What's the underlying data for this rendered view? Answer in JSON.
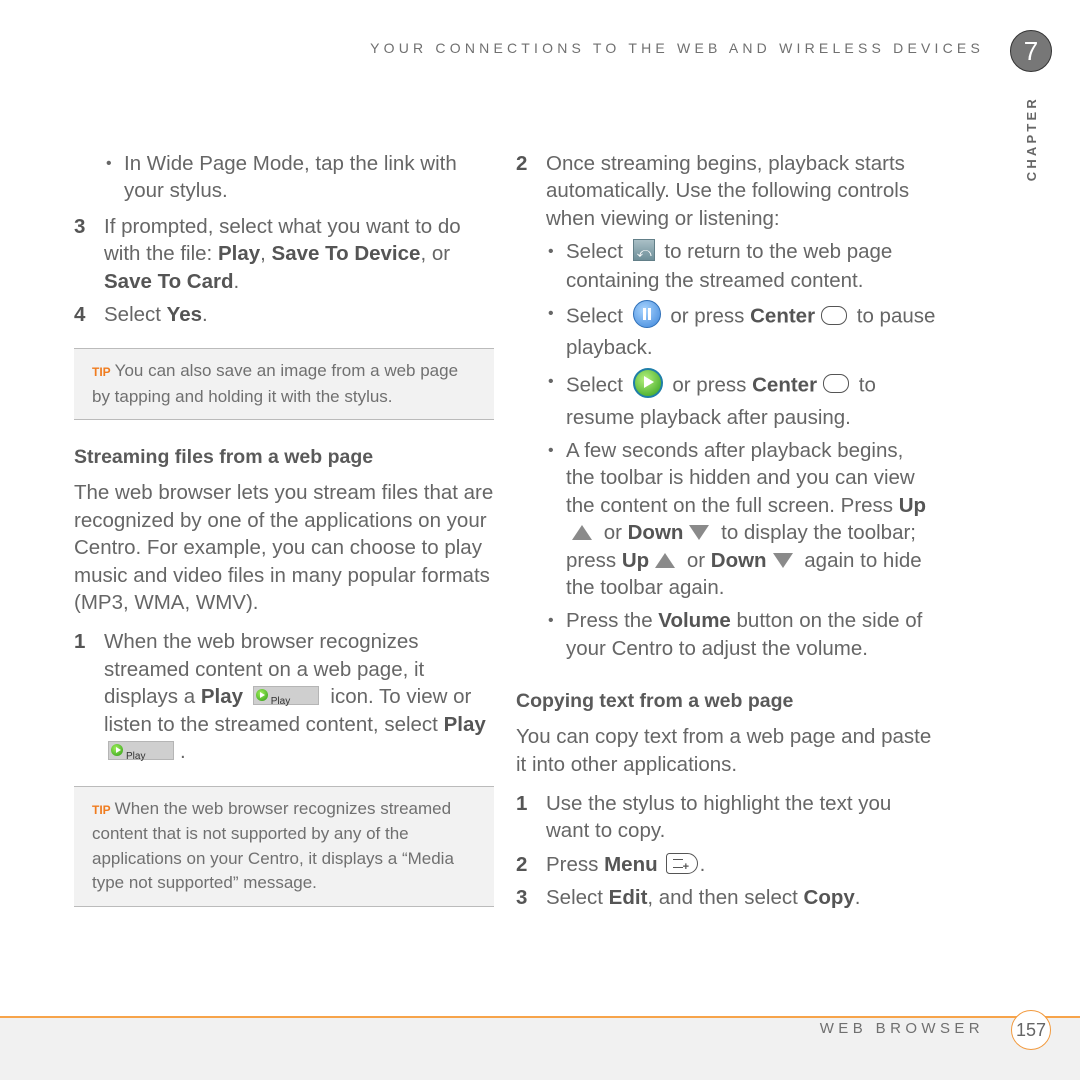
{
  "header": {
    "running_head": "YOUR CONNECTIONS TO THE WEB AND WIRELESS DEVICES",
    "chapter_number": "7",
    "chapter_label": "CHAPTER"
  },
  "left": {
    "bullet_wide_page": "In Wide Page Mode, tap the link with your stylus.",
    "step3": {
      "num": "3",
      "text_a": "If prompted, select what you want to do with the file: ",
      "bold_play": "Play",
      "sep1": ", ",
      "bold_save_device": "Save To Device",
      "sep2": ", or ",
      "bold_save_card": "Save To Card",
      "end": "."
    },
    "step4": {
      "num": "4",
      "text_a": "Select ",
      "bold_yes": "Yes",
      "end": "."
    },
    "tip1": {
      "label": "TIP",
      "text": "You can also save an image from a web page by tapping and holding it with the stylus."
    },
    "section_heading": "Streaming files from a web page",
    "intro": "The web browser lets you stream files that are recognized by one of the applications on your Centro. For example, you can choose to play music and video files in many popular formats (MP3, WMA, WMV).",
    "step1": {
      "num": "1",
      "text_a": "When the web browser recognizes streamed content on a web page, it displays a ",
      "bold_play": "Play",
      "text_b": " icon. To view or listen to the streamed content, select ",
      "bold_play2": "Play",
      "end": "."
    },
    "play_icon_label": "Play",
    "tip2": {
      "label": "TIP",
      "text": "When the web browser recognizes streamed content that is not supported by any of the applications on your Centro, it displays a “Media type not supported” message."
    }
  },
  "right": {
    "step2": {
      "num": "2",
      "text": "Once streaming begins, playback starts automatically. Use the following controls when viewing or listening:"
    },
    "bullet_back": {
      "a": "Select ",
      "b": " to return to the web page containing the streamed content."
    },
    "bullet_pause": {
      "a": "Select ",
      "b": " or press ",
      "bold_center": "Center",
      "c": " to pause playback."
    },
    "bullet_resume": {
      "a": "Select ",
      "b": " or press ",
      "bold_center": "Center",
      "c": " to resume playback after pausing."
    },
    "bullet_toolbar": {
      "a": "A few seconds after playback begins, the toolbar is hidden and you can view the content on the full screen. Press ",
      "bold_up": "Up",
      "or1": " or ",
      "bold_down": "Down",
      "b": " to display the toolbar; press ",
      "bold_up2": "Up",
      "or2": " or ",
      "bold_down2": "Down",
      "c": " again to hide the toolbar again."
    },
    "bullet_volume": {
      "a": "Press the ",
      "bold_volume": "Volume",
      "b": " button on the side of your Centro to adjust the volume."
    },
    "section_heading": "Copying text from a web page",
    "intro": "You can copy text from a web page and paste it into other applications.",
    "copy_step1": {
      "num": "1",
      "text": "Use the stylus to highlight the text you want to copy."
    },
    "copy_step2": {
      "num": "2",
      "text_a": "Press ",
      "bold_menu": "Menu",
      "end": "."
    },
    "copy_step3": {
      "num": "3",
      "text_a": "Select ",
      "bold_edit": "Edit",
      "text_b": ", and then select ",
      "bold_copy": "Copy",
      "end": "."
    }
  },
  "footer": {
    "section_title": "WEB BROWSER",
    "page_number": "157"
  },
  "colors": {
    "accent_orange": "#f07c1f",
    "footer_line": "#f7a44a",
    "text_gray": "#666666",
    "tip_bg": "#f2f2f2"
  }
}
